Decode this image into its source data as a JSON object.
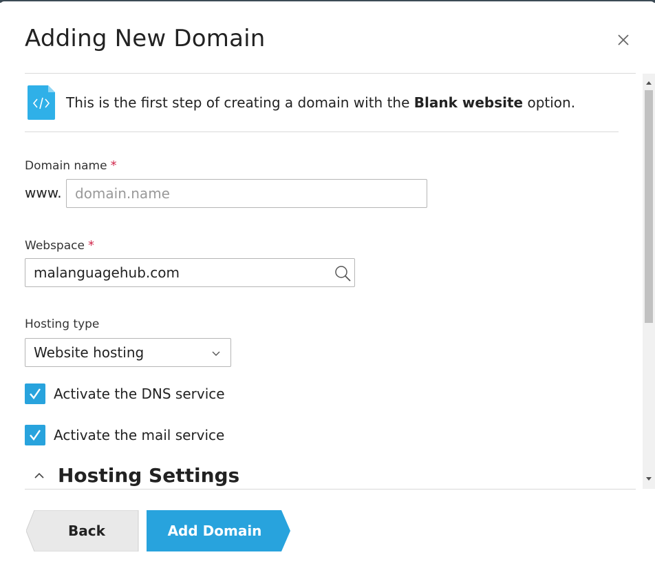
{
  "dialog": {
    "title": "Adding New Domain"
  },
  "info": {
    "text_before": "This is the first step of creating a domain with the ",
    "text_bold": "Blank website",
    "text_after": " option."
  },
  "fields": {
    "domain_name": {
      "label": "Domain name",
      "required_mark": "*",
      "prefix": "www.",
      "placeholder": "domain.name",
      "value": ""
    },
    "webspace": {
      "label": "Webspace",
      "required_mark": "*",
      "value": "malanguagehub.com"
    },
    "hosting_type": {
      "label": "Hosting type",
      "value": "Website hosting"
    },
    "dns_service": {
      "label": "Activate the DNS service",
      "checked": true
    },
    "mail_service": {
      "label": "Activate the mail service",
      "checked": true
    }
  },
  "section": {
    "title": "Hosting Settings"
  },
  "buttons": {
    "back": "Back",
    "add": "Add Domain"
  },
  "colors": {
    "accent": "#28a3dd",
    "required": "#d0274b",
    "back_bg": "#e9e9e9"
  }
}
